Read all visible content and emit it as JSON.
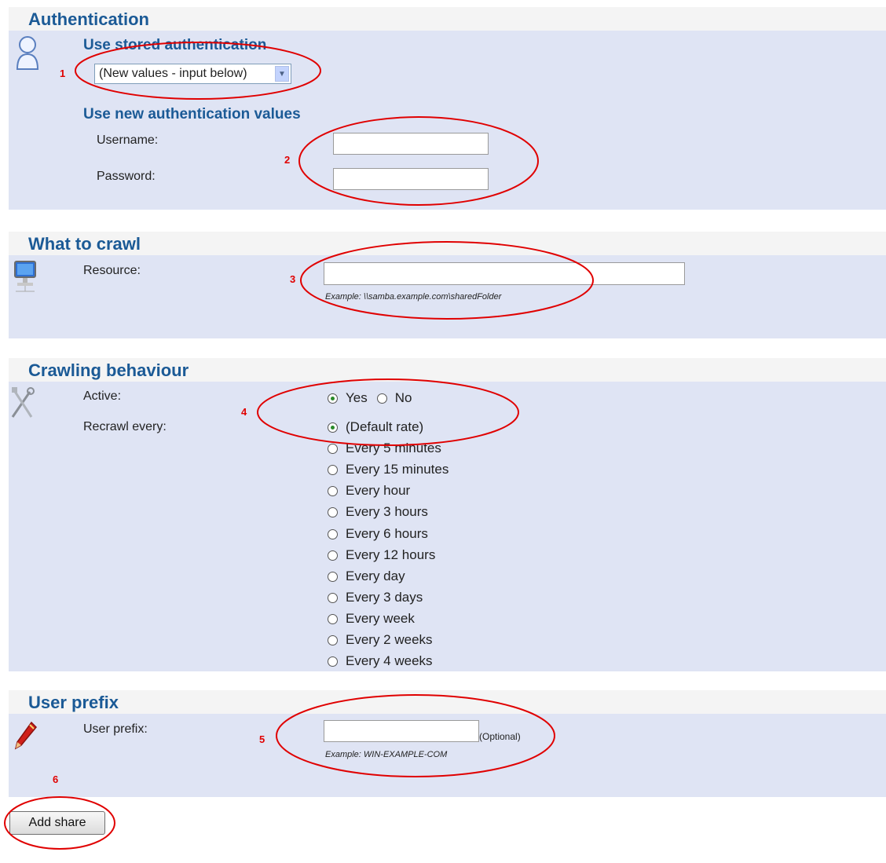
{
  "authentication": {
    "title": "Authentication",
    "stored_heading": "Use stored authentication",
    "stored_select_value": "(New values - input below)",
    "new_heading": "Use new authentication values",
    "username_label": "Username:",
    "username_value": "",
    "password_label": "Password:",
    "password_value": ""
  },
  "what_to_crawl": {
    "title": "What to crawl",
    "resource_label": "Resource:",
    "resource_value": "",
    "resource_example": "Example: \\\\samba.example.com\\sharedFolder"
  },
  "crawling": {
    "title": "Crawling behaviour",
    "active_label": "Active:",
    "active_options": [
      {
        "label": "Yes",
        "checked": true
      },
      {
        "label": "No",
        "checked": false
      }
    ],
    "recrawl_label": "Recrawl every:",
    "recrawl_options": [
      {
        "label": "(Default rate)",
        "checked": true
      },
      {
        "label": "Every 5 minutes",
        "checked": false
      },
      {
        "label": "Every 15 minutes",
        "checked": false
      },
      {
        "label": "Every hour",
        "checked": false
      },
      {
        "label": "Every 3 hours",
        "checked": false
      },
      {
        "label": "Every 6 hours",
        "checked": false
      },
      {
        "label": "Every 12 hours",
        "checked": false
      },
      {
        "label": "Every day",
        "checked": false
      },
      {
        "label": "Every 3 days",
        "checked": false
      },
      {
        "label": "Every week",
        "checked": false
      },
      {
        "label": "Every 2 weeks",
        "checked": false
      },
      {
        "label": "Every 4 weeks",
        "checked": false
      }
    ]
  },
  "user_prefix": {
    "title": "User prefix",
    "label": "User prefix:",
    "value": "",
    "optional_note": "(Optional)",
    "example": "Example: WIN-EXAMPLE-COM"
  },
  "submit": {
    "label": "Add share"
  },
  "annotations": [
    "1",
    "2",
    "3",
    "4",
    "5",
    "6"
  ],
  "icons": {
    "authentication": "user-icon",
    "what_to_crawl": "computer-icon",
    "crawling": "tools-icon",
    "user_prefix": "pen-icon"
  },
  "colors": {
    "heading": "#1b5a96",
    "panel": "#dfe4f4",
    "annotation": "#e00000"
  }
}
